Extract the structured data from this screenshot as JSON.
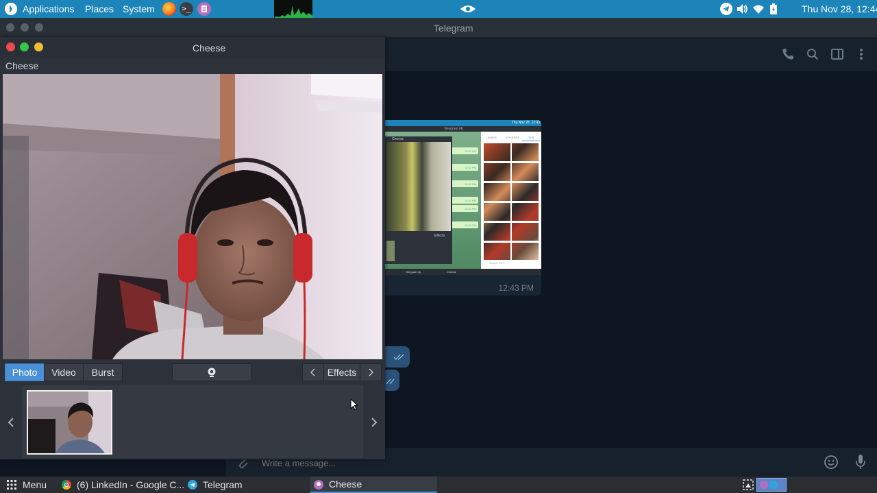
{
  "top_panel": {
    "menus": [
      "Applications",
      "Places",
      "System"
    ],
    "clock": "Thu Nov 28, 12:44",
    "icons": [
      "distro-logo-icon",
      "firefox-icon",
      "terminal-icon",
      "text-editor-icon",
      "system-monitor-graph",
      "eye-icon",
      "telegram-tray-icon",
      "volume-icon",
      "wifi-icon",
      "battery-icon"
    ]
  },
  "telegram": {
    "title": "Telegram",
    "header_icons": [
      "phone-icon",
      "search-icon",
      "sidebar-icon",
      "more-icon"
    ],
    "message_time": "12:43 PM",
    "input_placeholder": "Write a message...",
    "preview": {
      "topbar_clock": "Thu Nov 28, 12:43",
      "window_title": "Telegram (4)",
      "cheese_title": "Cheese",
      "tabs": [
        "IMAGE",
        "STICKERS",
        "GIFS"
      ],
      "times": [
        "12:42 PM",
        "12:42 PM",
        "12:42 PM",
        "12:42 PM",
        "12:42 PM",
        "12:42 PM"
      ],
      "effects": "Effects",
      "search": "Search GIFs",
      "taskbar": [
        "Telegram (4)",
        "Cheese"
      ]
    }
  },
  "cheese": {
    "title": "Cheese",
    "menu_label": "Cheese",
    "modes": [
      "Photo",
      "Video",
      "Burst"
    ],
    "active_mode": "Photo",
    "effects_label": "Effects"
  },
  "taskbar": {
    "menu": "Menu",
    "items": [
      "(6) LinkedIn - Google C...",
      "Telegram",
      "Cheese"
    ],
    "active": "Cheese"
  },
  "colors": {
    "panel": "#1c84b8",
    "telegram_bg": "#0e1621",
    "telegram_header": "#17212b",
    "accent": "#4a90d9",
    "outgoing_bubble": "#2b5278"
  }
}
